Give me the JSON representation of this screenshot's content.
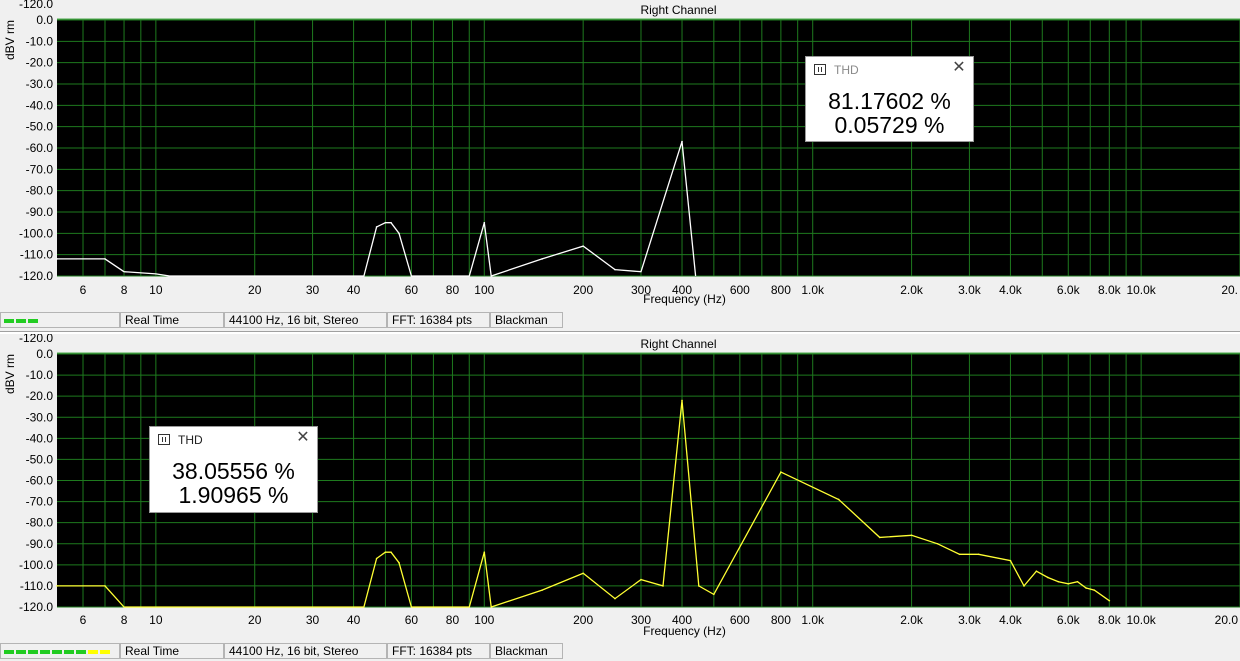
{
  "y_axis_label": "dBV rm",
  "frequency_label": "Frequency (Hz)",
  "y_ticks": [
    "-120.0",
    "0.0",
    "-10.0",
    "-20.0",
    "-30.0",
    "-40.0",
    "-50.0",
    "-60.0",
    "-70.0",
    "-80.0",
    "-90.0",
    "-100.0",
    "-110.0",
    "-120.0"
  ],
  "x_ticks": [
    {
      "f": 6,
      "label": "6"
    },
    {
      "f": 8,
      "label": "8"
    },
    {
      "f": 10,
      "label": "10"
    },
    {
      "f": 20,
      "label": "20"
    },
    {
      "f": 30,
      "label": "30"
    },
    {
      "f": 40,
      "label": "40"
    },
    {
      "f": 60,
      "label": "60"
    },
    {
      "f": 80,
      "label": "80"
    },
    {
      "f": 100,
      "label": "100"
    },
    {
      "f": 200,
      "label": "200"
    },
    {
      "f": 300,
      "label": "300"
    },
    {
      "f": 400,
      "label": "400"
    },
    {
      "f": 600,
      "label": "600"
    },
    {
      "f": 800,
      "label": "800"
    },
    {
      "f": 1000,
      "label": "1.0k"
    },
    {
      "f": 2000,
      "label": "2.0k"
    },
    {
      "f": 3000,
      "label": "3.0k"
    },
    {
      "f": 4000,
      "label": "4.0k"
    },
    {
      "f": 6000,
      "label": "6.0k"
    },
    {
      "f": 8000,
      "label": "8.0k"
    },
    {
      "f": 10000,
      "label": "10.0k"
    },
    {
      "f": 20000,
      "label": "20."
    }
  ],
  "x_ticks_bottom_last_label": "20.0",
  "colors": {
    "plot_bg": "#000000",
    "grid": "#1e7a1e",
    "trace": "#ffffff",
    "trace_yellow": "#ffff33",
    "axis_top": "#4da84d"
  },
  "panels": [
    {
      "title": "Right Channel",
      "thd": {
        "title": "THD",
        "value1": "81.17602 %",
        "value2": "0.05729 %",
        "close_icon": "close-icon"
      },
      "status": {
        "mode": "Real Time",
        "format": "44100 Hz, 16 bit, Stereo",
        "fft": "FFT: 16384 pts",
        "window": "Blackman"
      },
      "meter": {
        "green": 3,
        "yellow": 0
      },
      "trace_color": "#ffffff",
      "chart_data": {
        "type": "line",
        "xscale": "log",
        "xlim": [
          5,
          20000
        ],
        "ylim": [
          -120,
          0
        ],
        "xlabel": "Frequency (Hz)",
        "ylabel": "dBV rm",
        "series": [
          {
            "x": [
              5,
              7,
              8,
              10,
              11,
              43,
              47,
              50,
              52,
              55,
              60,
              90,
              100,
              105,
              150,
              200,
              250,
              300,
              400,
              440
            ],
            "y": [
              -112,
              -112,
              -118,
              -119,
              -120,
              -120,
              -97,
              -95,
              -95,
              -100,
              -120,
              -120,
              -95,
              -120,
              -112,
              -106,
              -117,
              -118,
              -57,
              -120
            ]
          }
        ]
      }
    },
    {
      "title": "Right Channel",
      "thd": {
        "title": "THD",
        "value1": "38.05556 %",
        "value2": "1.90965 %",
        "close_icon": "close-icon"
      },
      "status": {
        "mode": "Real Time",
        "format": "44100 Hz, 16 bit, Stereo",
        "fft": "FFT: 16384 pts",
        "window": "Blackman"
      },
      "meter": {
        "green": 7,
        "yellow": 2
      },
      "trace_color": "#ffff33",
      "chart_data": {
        "type": "line",
        "xscale": "log",
        "xlim": [
          5,
          20000
        ],
        "ylim": [
          -120,
          0
        ],
        "xlabel": "Frequency (Hz)",
        "ylabel": "dBV rm",
        "series": [
          {
            "x": [
              5,
              7,
              8,
              43,
              47,
              50,
              52,
              55,
              60,
              90,
              100,
              105,
              150,
              200,
              250,
              300,
              350,
              400,
              450,
              500,
              800,
              1200,
              1600,
              2000,
              2400,
              2800,
              3200,
              4000,
              4400,
              4800,
              5200,
              5600,
              6000,
              6400,
              6800,
              7200,
              8000
            ],
            "y": [
              -110,
              -110,
              -120,
              -120,
              -97,
              -94,
              -94,
              -99,
              -120,
              -120,
              -94,
              -120,
              -112,
              -104,
              -116,
              -107,
              -110,
              -22,
              -110,
              -114,
              -56,
              -69,
              -87,
              -86,
              -90,
              -95,
              -95,
              -98,
              -110,
              -103,
              -106,
              -108,
              -109,
              -108,
              -111,
              -112,
              -117
            ]
          }
        ]
      }
    }
  ]
}
